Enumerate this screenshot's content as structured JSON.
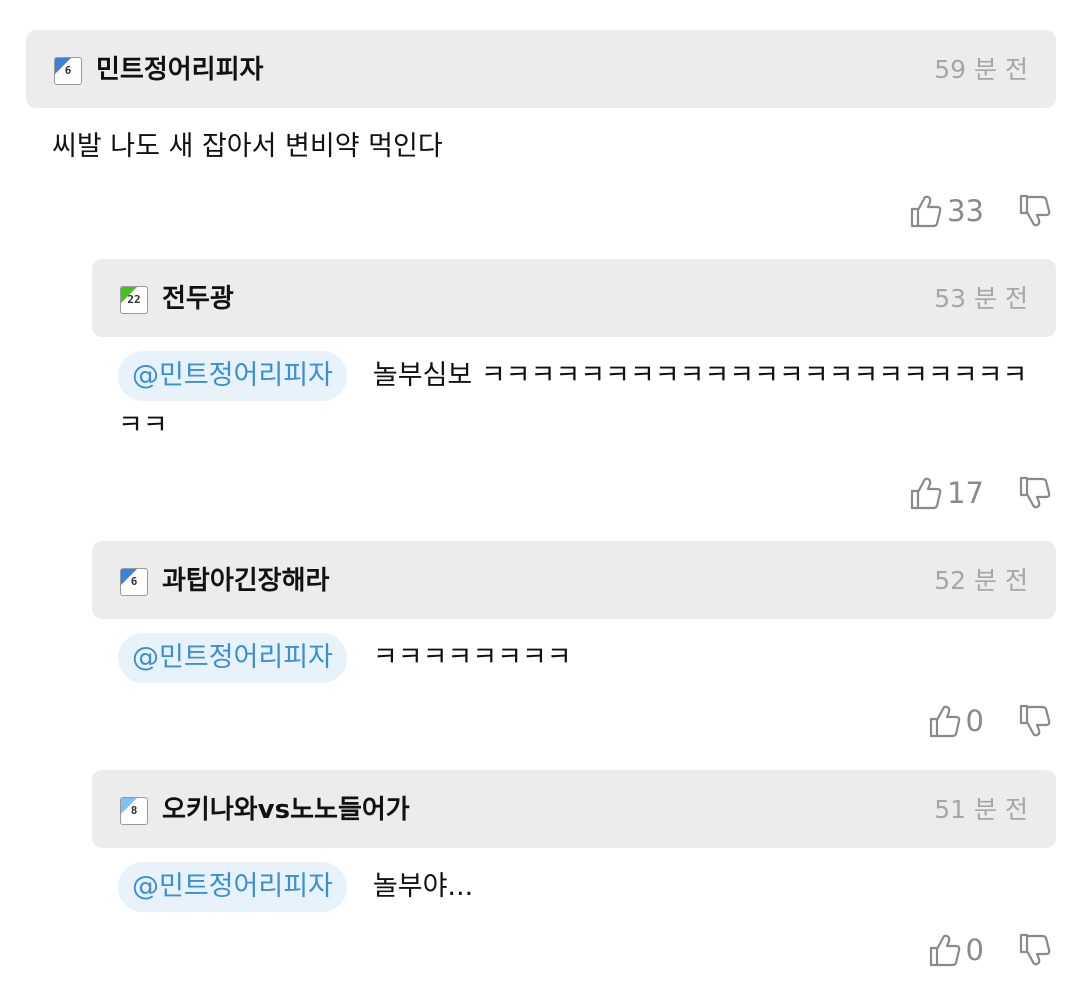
{
  "comments": [
    {
      "nickname": "민트정어리피자",
      "level_badge": "6",
      "time": "59 분 전",
      "mention": "",
      "text": "씨발 나도 새 잡아서 변비약 먹인다",
      "likes": "33"
    },
    {
      "nickname": "전두광",
      "level_badge": "22",
      "time": "53 분 전",
      "mention": "@민트정어리피자",
      "text": "놀부심보 ㅋㅋㅋㅋㅋㅋㅋㅋㅋㅋㅋㅋㅋㅋㅋㅋㅋㅋㅋㅋㅋㅋㅋㅋ",
      "likes": "17"
    },
    {
      "nickname": "과탑아긴장해라",
      "level_badge": "6",
      "time": "52 분 전",
      "mention": "@민트정어리피자",
      "text": "ㅋㅋㅋㅋㅋㅋㅋㅋ",
      "likes": "0"
    },
    {
      "nickname": "오키나와vs노노들어가",
      "level_badge": "8",
      "time": "51 분 전",
      "mention": "@민트정어리피자",
      "text": "놀부야...",
      "likes": "0"
    }
  ],
  "icons": {
    "like": "thumbs-up-outline-icon",
    "dislike": "thumbs-down-outline-icon"
  },
  "colors": {
    "header_bg": "#ececec",
    "mention_bg": "#e7f2fb",
    "mention_text": "#3b8fd8",
    "time_text": "#a6a6a6",
    "vote_text": "#8a8a8a"
  }
}
